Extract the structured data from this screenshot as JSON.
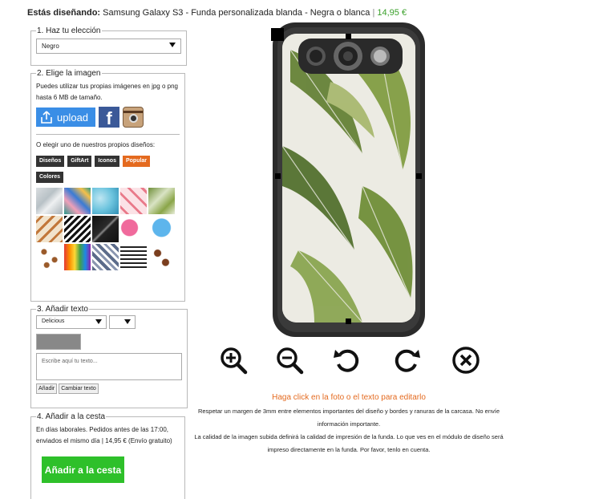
{
  "header": {
    "prefix": "Estás diseñando:",
    "product": "Samsung Galaxy S3 - Funda personalizada blanda - Negra o blanca",
    "separator": "|",
    "price": "14,95 €"
  },
  "step1": {
    "legend": "1. Haz tu elección",
    "selected": "Negro"
  },
  "step2": {
    "legend": "2. Elige la imagen",
    "description": "Puedes utilizar tus propias imágenes en jpg o png hasta 6 MB de tamaño.",
    "upload_label": "upload",
    "facebook_label": "f",
    "or_label": "O elegir uno de nuestros propios diseños:",
    "categories": [
      {
        "label": "Diseños",
        "active": false
      },
      {
        "label": "GiftArt",
        "active": false
      },
      {
        "label": "Iconos",
        "active": false
      },
      {
        "label": "Popular",
        "active": true
      },
      {
        "label": "Colores",
        "active": false
      }
    ]
  },
  "step3": {
    "legend": "3. Añadir texto",
    "font": "Delicious",
    "size": "",
    "color": "#888888",
    "placeholder": "Escribe aquí tu texto...",
    "add_button": "Añadir",
    "change_button": "Cambiar texto"
  },
  "step4": {
    "legend": "4. Añadir a la cesta",
    "info": "En días laborales. Pedidos antes de las 17:00, enviados el mismo día | 14,95 € (Envío gratuito)",
    "cart_button": "Añadir a la cesta"
  },
  "editor": {
    "hint": "Haga click en la foto o el texto para editarlo",
    "info_lines": [
      "Respetar un margen de 3mm entre elementos importantes del diseño y bordes y ranuras de la carcasa. No envíe",
      "información importante.",
      "La calidad de la imagen subida definirá la calidad de impresión de la funda. Lo que ves en el módulo de diseño será",
      "impreso directamente en la funda. Por favor, tenlo en cuenta."
    ],
    "tools": [
      "zoom-in-icon",
      "zoom-out-icon",
      "rotate-left-icon",
      "rotate-right-icon",
      "delete-icon"
    ]
  },
  "colors": {
    "accent_orange": "#e46a1f",
    "price_green": "#3aa02a",
    "upload_blue": "#3a8ee6",
    "cart_green": "#2ec02a"
  }
}
